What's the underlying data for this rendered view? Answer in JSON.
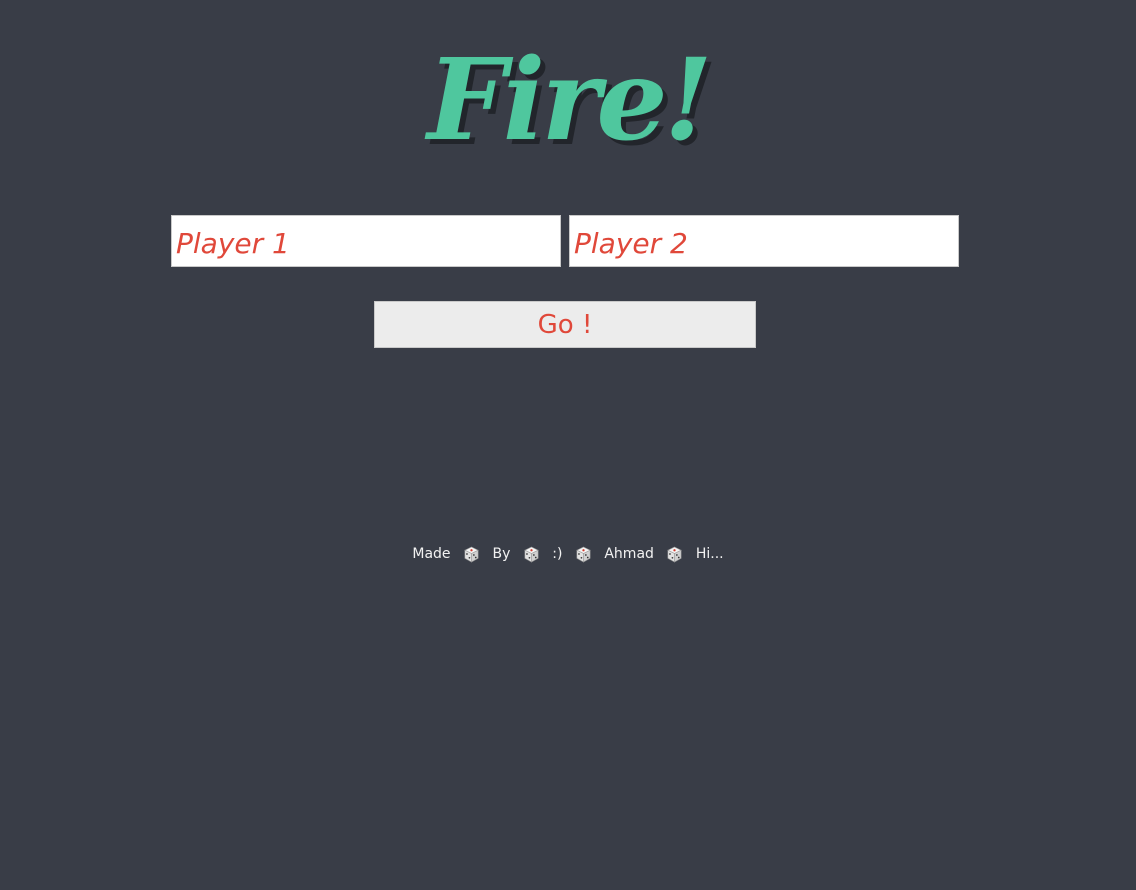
{
  "header": {
    "title": "Fire!"
  },
  "form": {
    "player1_placeholder": "Player 1",
    "player2_placeholder": "Player 2",
    "go_label": "Go !"
  },
  "footer": {
    "parts": [
      "Made",
      "By",
      ":)",
      "Ahmad",
      "Hi..."
    ],
    "separator_icon": "dice-icon"
  },
  "colors": {
    "background": "#393d47",
    "logo": "#4fc79e",
    "accent_text": "#e0483a",
    "footer_text": "#f2f2f2"
  }
}
